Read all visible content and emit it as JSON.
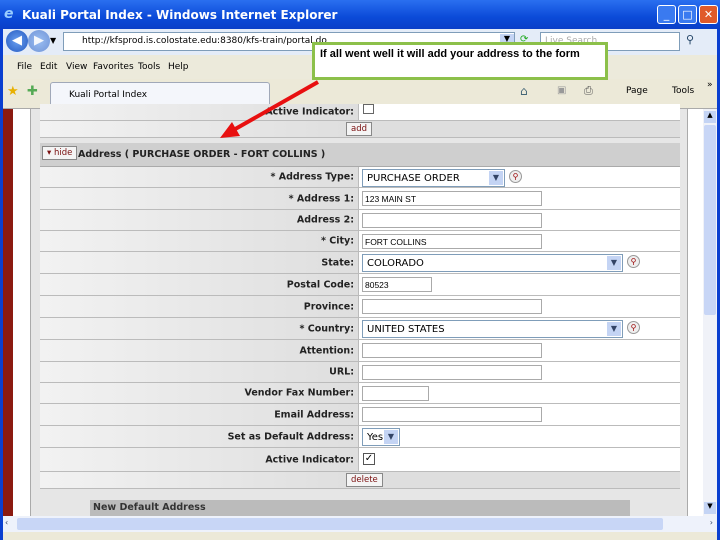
{
  "window": {
    "title": "Kuali Portal Index - Windows Internet Explorer",
    "minimize": "_",
    "maximize": "□",
    "close": "✕"
  },
  "browser": {
    "url": "http://kfsprod.is.colostate.edu:8380/kfs-train/portal.do",
    "search_placeholder": "Live Search",
    "tab": "Kuali Portal Index",
    "menu": [
      "File",
      "Edit",
      "View",
      "Favorites",
      "Tools",
      "Help"
    ],
    "toolbar": {
      "page": "Page",
      "tools": "Tools"
    }
  },
  "callout": "If all went well it will add your address to the form",
  "form": {
    "prev_active_label": "Active Indicator:",
    "add_label": "add",
    "hide_label": "hide",
    "section_title": "Address ( PURCHASE ORDER - FORT COLLINS )",
    "fields": {
      "address_type": {
        "label": "*  Address Type:",
        "value": "PURCHASE ORDER"
      },
      "address1": {
        "label": "*  Address 1:",
        "value": "123 MAIN ST"
      },
      "address2": {
        "label": "Address 2:",
        "value": ""
      },
      "city": {
        "label": "*  City:",
        "value": "FORT COLLINS"
      },
      "state": {
        "label": "State:",
        "value": "COLORADO"
      },
      "postal": {
        "label": "Postal Code:",
        "value": "80523"
      },
      "province": {
        "label": "Province:",
        "value": ""
      },
      "country": {
        "label": "*  Country:",
        "value": "UNITED STATES"
      },
      "attention": {
        "label": "Attention:",
        "value": ""
      },
      "url": {
        "label": "URL:",
        "value": ""
      },
      "fax": {
        "label": "Vendor Fax Number:",
        "value": ""
      },
      "email": {
        "label": "Email Address:",
        "value": ""
      },
      "default": {
        "label": "Set as Default Address:",
        "value": "Yes"
      },
      "active": {
        "label": "Active Indicator:",
        "checked": true
      }
    },
    "delete_label": "delete",
    "next_section": "New Default Address"
  },
  "colors": {
    "callout_border": "#8cc04a",
    "arrow": "#e81010",
    "title_bar": "#0b4ad8"
  }
}
